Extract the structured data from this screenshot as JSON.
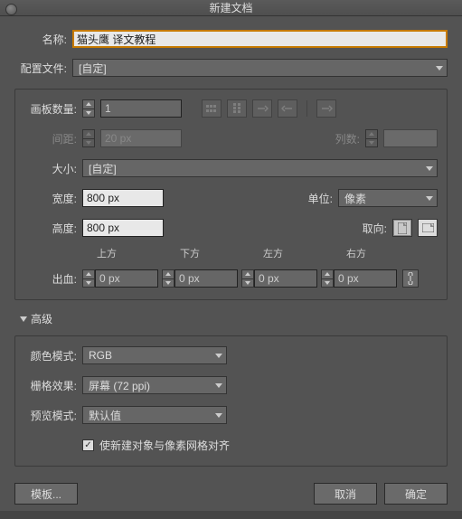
{
  "title": "新建文档",
  "name": {
    "label": "名称:",
    "value": "猫头鹰 译文教程"
  },
  "profile": {
    "label": "配置文件:",
    "value": "[自定]"
  },
  "artboards": {
    "label": "画板数量:",
    "value": "1"
  },
  "spacing": {
    "label": "间距:",
    "value": "20 px"
  },
  "columns": {
    "label": "列数:",
    "value": ""
  },
  "size": {
    "label": "大小:",
    "value": "[自定]"
  },
  "width": {
    "label": "宽度:",
    "value": "800 px"
  },
  "height": {
    "label": "高度:",
    "value": "800 px"
  },
  "units": {
    "label": "单位:",
    "value": "像素"
  },
  "orientation": {
    "label": "取向:"
  },
  "bleed": {
    "label": "出血:",
    "top": {
      "label": "上方",
      "value": "0 px"
    },
    "bottom": {
      "label": "下方",
      "value": "0 px"
    },
    "left": {
      "label": "左方",
      "value": "0 px"
    },
    "right": {
      "label": "右方",
      "value": "0 px"
    }
  },
  "advanced": {
    "label": "高级"
  },
  "colorMode": {
    "label": "颜色模式:",
    "value": "RGB"
  },
  "raster": {
    "label": "栅格效果:",
    "value": "屏幕 (72 ppi)"
  },
  "preview": {
    "label": "预览模式:",
    "value": "默认值"
  },
  "alignGrid": {
    "label": "使新建对象与像素网格对齐",
    "checked": true
  },
  "buttons": {
    "template": "模板...",
    "cancel": "取消",
    "ok": "确定"
  }
}
